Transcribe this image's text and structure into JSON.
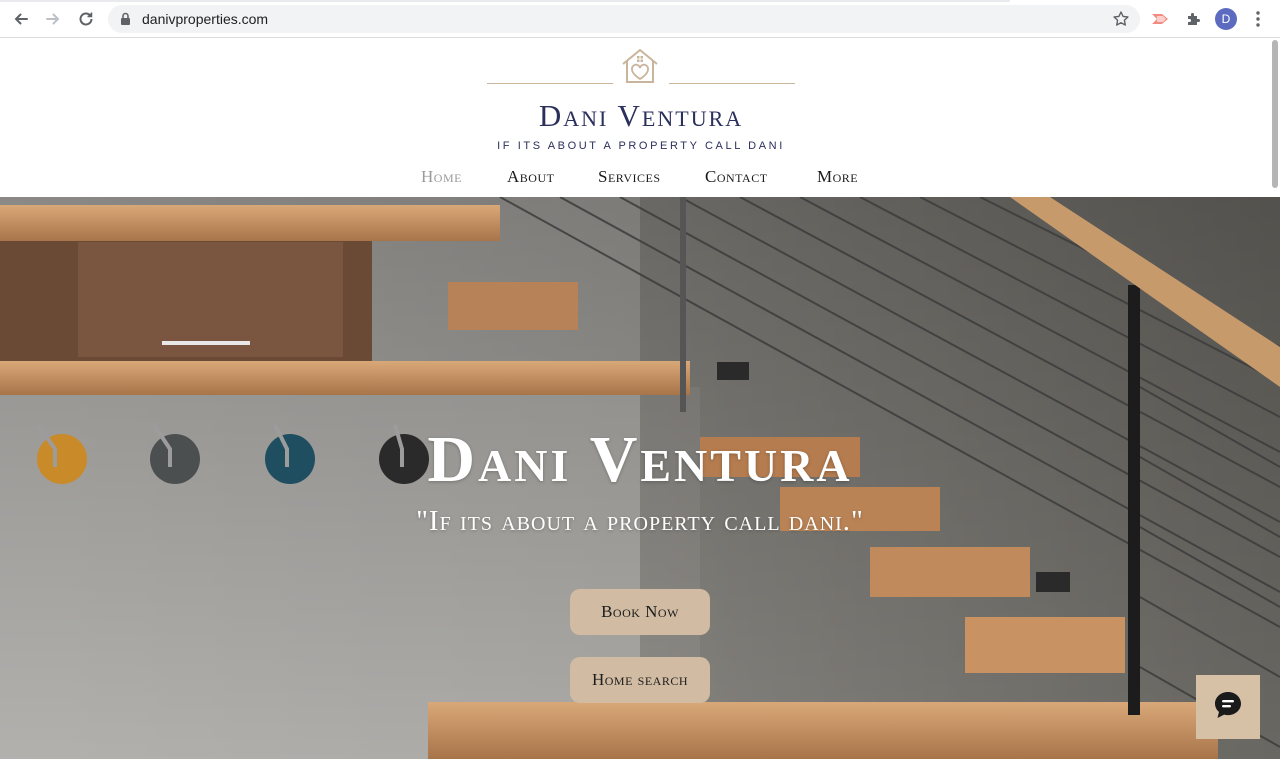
{
  "browser": {
    "url": "danivproperties.com",
    "avatar_letter": "D",
    "icons": [
      "back-arrow-icon",
      "forward-arrow-icon",
      "reload-icon",
      "lock-icon",
      "star-icon",
      "extension-icon",
      "puzzle-icon",
      "kebab-menu-icon"
    ]
  },
  "site": {
    "logo": {
      "name": "Dani Ventura",
      "tagline": "If its about a property call dani",
      "icon": "house-heart-icon"
    },
    "menu": [
      {
        "label": "Home",
        "active": true
      },
      {
        "label": "About",
        "active": false
      },
      {
        "label": "Services",
        "active": false
      },
      {
        "label": "Contact",
        "active": false
      },
      {
        "label": "More",
        "active": false
      }
    ]
  },
  "hero": {
    "title": "Dani Ventura",
    "subtitle": "\"If its about a property call dani.\"",
    "buttons": [
      {
        "label": "Book Now"
      },
      {
        "label": "Home search"
      }
    ]
  },
  "chat": {
    "icon": "chat-bubble-icon"
  },
  "colors": {
    "brand_navy": "#2b2f5c",
    "brand_tan": "#d1bca3",
    "menu_active": "#9a9a9a"
  }
}
